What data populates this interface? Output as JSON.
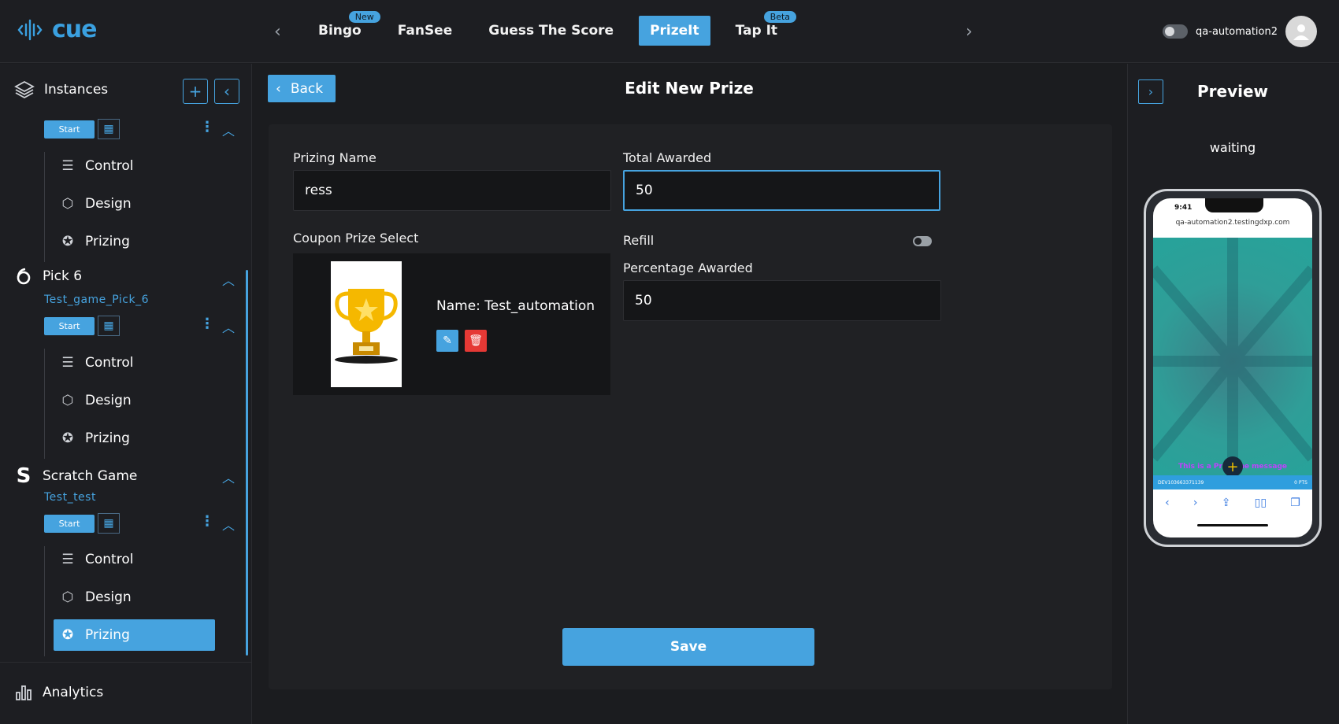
{
  "app": {
    "logo": "cue"
  },
  "nav": {
    "items": [
      {
        "label": "Bingo",
        "badge": "New"
      },
      {
        "label": "FanSee",
        "badge": ""
      },
      {
        "label": "Guess The Score",
        "badge": ""
      },
      {
        "label": "PrizeIt",
        "badge": "",
        "active": true
      },
      {
        "label": "Tap It",
        "badge": "Beta"
      }
    ]
  },
  "user": {
    "name": "qa-automation2"
  },
  "sidebar": {
    "header": "Instances",
    "start_label": "Start",
    "groups": [
      {
        "title": "",
        "subtitle": "",
        "items": [
          "Control",
          "Design",
          "Prizing"
        ]
      },
      {
        "title": "Pick 6",
        "subtitle": "Test_game_Pick_6",
        "items": [
          "Control",
          "Design",
          "Prizing"
        ]
      },
      {
        "title": "Scratch Game",
        "subtitle": "Test_test",
        "items": [
          "Control",
          "Design",
          "Prizing"
        ]
      }
    ],
    "analytics": "Analytics"
  },
  "main": {
    "back_label": "Back",
    "title": "Edit New Prize",
    "prizing_name_label": "Prizing Name",
    "prizing_name_value": "ress",
    "total_awarded_label": "Total Awarded",
    "total_awarded_value": "50",
    "coupon_label": "Coupon Prize Select",
    "coupon_name_prefix": "Name:",
    "coupon_name": "Test_automation",
    "refill_label": "Refill",
    "percentage_label": "Percentage Awarded",
    "percentage_value": "50",
    "save_label": "Save"
  },
  "preview": {
    "title": "Preview",
    "status": "waiting",
    "phone_time": "9:41",
    "url": "qa-automation2.testingdxp.com",
    "pregame_message": "This is a Pregame message",
    "bottom_id": "DEV103663371139",
    "bottom_pts": "0 PTS"
  },
  "colors": {
    "accent": "#46a3df",
    "danger": "#e53935",
    "bg": "#1b1c1f"
  }
}
